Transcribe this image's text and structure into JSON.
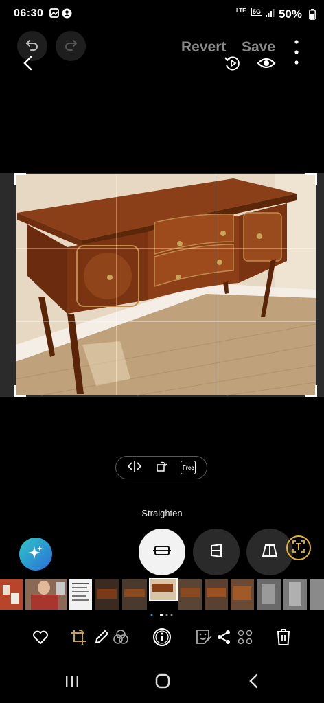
{
  "status_bar": {
    "time": "06:30",
    "network": "LTE",
    "signal_label": "5G",
    "battery": "50%"
  },
  "toolbar": {
    "revert_label": "Revert",
    "save_label": "Save"
  },
  "crop_controls": {
    "free_label": "Free"
  },
  "transform": {
    "active_label": "Straighten"
  },
  "colors": {
    "background": "#000000",
    "accent_ai": "#2a8fd8",
    "text_icon_gold": "#e8b62a",
    "inactive_text": "#8a8a8a",
    "tool_button_bg": "#2a2a2a"
  },
  "icons": {
    "undo": "undo-icon",
    "redo": "redo-icon",
    "back": "back-chevron-icon",
    "video_replay": "video-replay-icon",
    "preview": "eye-icon",
    "more": "more-vert-icon",
    "flip": "flip-horizontal-icon",
    "rotate": "rotate-icon",
    "ratio": "aspect-ratio-icon",
    "ai": "sparkle-icon",
    "straighten": "straighten-icon",
    "vertical": "vertical-perspective-icon",
    "horizontal": "horizontal-perspective-icon",
    "text_extract": "text-extract-icon",
    "favorite": "heart-icon",
    "edit_transform": "crop-rotate-icon",
    "draw": "pencil-icon",
    "filters": "filters-icon",
    "info": "info-icon",
    "sticker": "sticker-icon",
    "share": "share-icon",
    "apps": "apps-icon",
    "delete": "trash-icon"
  }
}
